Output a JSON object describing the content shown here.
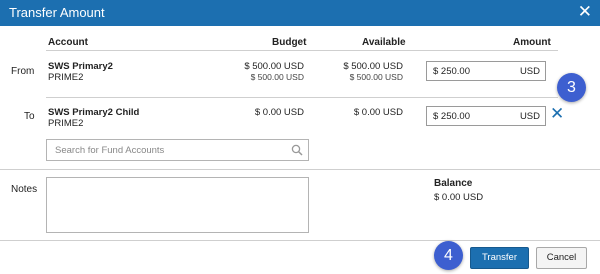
{
  "dialog": {
    "title": "Transfer Amount"
  },
  "table": {
    "headers": {
      "account": "Account",
      "budget": "Budget",
      "available": "Available",
      "amount": "Amount"
    },
    "from": {
      "label": "From",
      "account_name": "SWS Primary2",
      "account_sub": "PRIME2",
      "budget_main": "$ 500.00 USD",
      "budget_sub": "$ 500.00 USD",
      "available_main": "$ 500.00 USD",
      "available_sub": "$ 500.00 USD",
      "amount_value": "$ 250.00",
      "amount_currency": "USD"
    },
    "to": {
      "label": "To",
      "account_name": "SWS Primary2 Child",
      "account_sub": "PRIME2",
      "budget_main": "$ 0.00 USD",
      "available_main": "$ 0.00 USD",
      "amount_value": "$ 250.00",
      "amount_currency": "USD"
    }
  },
  "search": {
    "placeholder": "Search for Fund Accounts"
  },
  "notes": {
    "label": "Notes",
    "value": ""
  },
  "balance": {
    "label": "Balance",
    "value": "$ 0.00 USD"
  },
  "callouts": {
    "step3": "3",
    "step4": "4"
  },
  "buttons": {
    "transfer": "Transfer",
    "cancel": "Cancel"
  },
  "icons": {
    "close": "close-icon",
    "remove": "remove-icon",
    "search": "search-icon"
  },
  "colors": {
    "header": "#1c6fb0",
    "badge": "#3d5fd0",
    "primary_button": "#1c6fb0"
  }
}
